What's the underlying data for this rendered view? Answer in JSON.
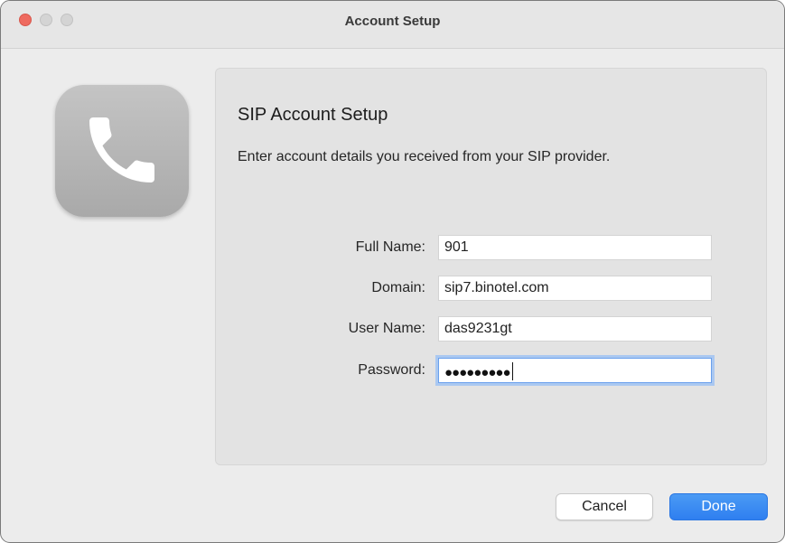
{
  "window": {
    "title": "Account Setup"
  },
  "icon": {
    "name": "phone-icon"
  },
  "panel": {
    "heading": "SIP Account Setup",
    "subtitle": "Enter account details you received from your SIP provider.",
    "fields": [
      {
        "label": "Full Name:",
        "value": "901"
      },
      {
        "label": "Domain:",
        "value": "sip7.binotel.com"
      },
      {
        "label": "User Name:",
        "value": "das9231gt"
      },
      {
        "label": "Password:",
        "value": "●●●●●●●●●"
      }
    ]
  },
  "buttons": {
    "cancel": "Cancel",
    "done": "Done"
  },
  "colors": {
    "accent": "#3b8ff2",
    "close": "#ee6a5f"
  }
}
